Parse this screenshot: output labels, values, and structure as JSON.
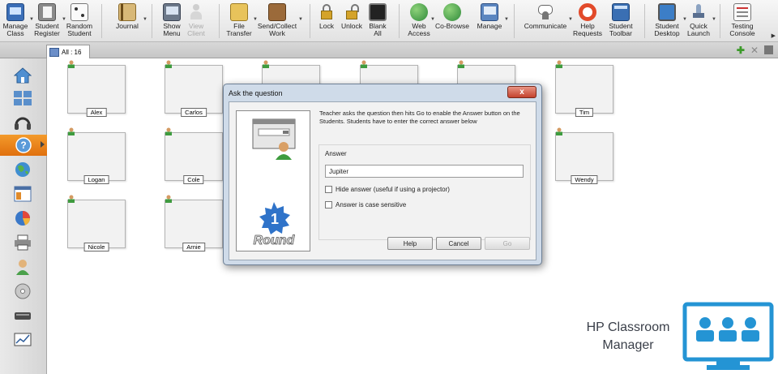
{
  "toolbar": {
    "manage_class": "Manage Class",
    "student_register": "Student Register",
    "random_student": "Random Student",
    "journal": "Journal",
    "show_menu": "Show Menu",
    "view_client": "View Client",
    "file_transfer": "File Transfer",
    "send_collect_work": "Send/Collect Work",
    "lock": "Lock",
    "unlock": "Unlock",
    "blank_all": "Blank All",
    "web_access": "Web Access",
    "co_browse": "Co-Browse",
    "manage": "Manage",
    "communicate": "Communicate",
    "help_requests": "Help Requests",
    "student_toolbar": "Student Toolbar",
    "student_desktop": "Student Desktop",
    "quick_launch": "Quick Launch",
    "testing_console": "Testing Console"
  },
  "tab": {
    "label": "All : 16"
  },
  "students": [
    "Alex",
    "Carlos",
    "Tim",
    "Logan",
    "Cole",
    "Wendy",
    "Nicole",
    "Arnie"
  ],
  "dialog": {
    "title": "Ask the question",
    "close": "x",
    "description": "Teacher asks the question then hits Go to enable the Answer button on the Students. Students have to enter the correct answer below",
    "answer_label": "Answer",
    "answer_value": "Jupiter",
    "hide_answer_label": "Hide answer (useful if using a projector)",
    "hide_answer_checked": false,
    "case_sensitive_label": "Answer is case sensitive",
    "case_sensitive_checked": false,
    "round_number": "1",
    "round_label": "Round",
    "help_label": "Help",
    "cancel_label": "Cancel",
    "go_label": "Go"
  },
  "watermark": {
    "line1": "HP Classroom",
    "line2": "Manager"
  },
  "colors": {
    "accent_orange": "#e97f1c",
    "brand_blue": "#2494d4",
    "round_badge": "#2f73c9"
  }
}
